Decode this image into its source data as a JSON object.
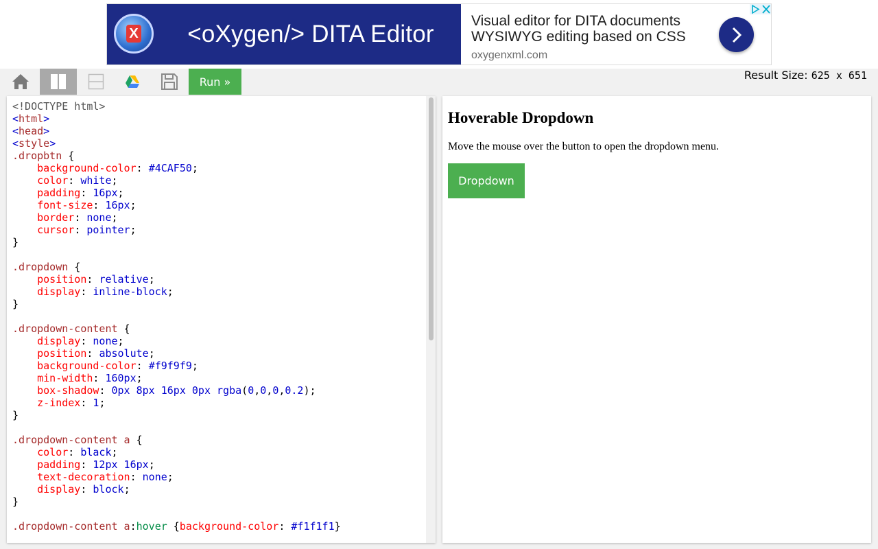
{
  "ad": {
    "headline": "<oXygen/> DITA Editor",
    "description_line1": "Visual editor for DITA documents",
    "description_line2": "WYSIWYG editing based on CSS",
    "display_url": "oxygenxml.com",
    "logo_letter": "X",
    "colors": {
      "brand": "#1d2b86"
    }
  },
  "toolbar": {
    "icons": [
      "home-icon",
      "columns-layout-icon",
      "rows-layout-icon",
      "google-drive-icon",
      "save-icon"
    ],
    "run_label": "Run »",
    "result_size": {
      "label": "Result Size: ",
      "width": "625",
      "separator": " x ",
      "height": "651"
    },
    "colors": {
      "run": "#4CAF50",
      "active_layout": "#a9a9a9"
    }
  },
  "editor": {
    "lines": [
      "<!DOCTYPE html>",
      "<html>",
      "<head>",
      "<style>",
      ".dropbtn {",
      "    background-color: #4CAF50;",
      "    color: white;",
      "    padding: 16px;",
      "    font-size: 16px;",
      "    border: none;",
      "    cursor: pointer;",
      "}",
      "",
      ".dropdown {",
      "    position: relative;",
      "    display: inline-block;",
      "}",
      "",
      ".dropdown-content {",
      "    display: none;",
      "    position: absolute;",
      "    background-color: #f9f9f9;",
      "    min-width: 160px;",
      "    box-shadow: 0px 8px 16px 0px rgba(0,0,0,0.2);",
      "    z-index: 1;",
      "}",
      "",
      ".dropdown-content a {",
      "    color: black;",
      "    padding: 12px 16px;",
      "    text-decoration: none;",
      "    display: block;",
      "}",
      "",
      ".dropdown-content a:hover {background-color: #f1f1f1}"
    ]
  },
  "result": {
    "heading": "Hoverable Dropdown",
    "description": "Move the mouse over the button to open the dropdown menu.",
    "dropdown_label": "Dropdown",
    "colors": {
      "button": "#4CAF50"
    }
  }
}
